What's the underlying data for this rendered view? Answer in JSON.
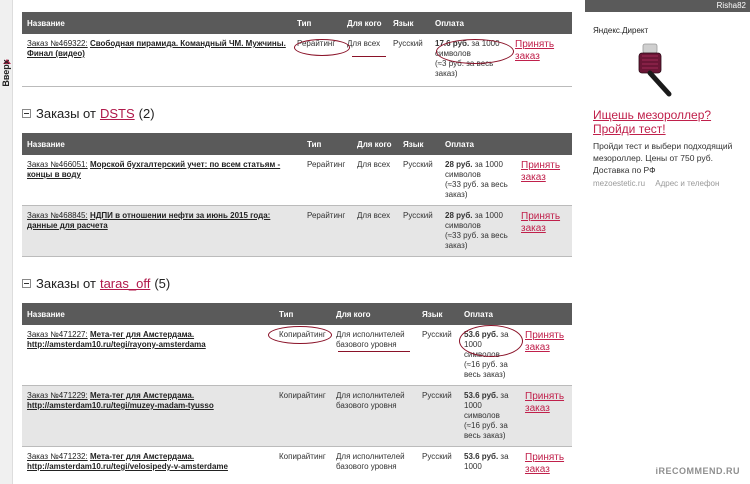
{
  "scroll_top": {
    "label": "Вверх"
  },
  "columns": {
    "name": "Название",
    "type": "Тип",
    "for_whom": "Для кого",
    "language": "Язык",
    "payment": "Оплата"
  },
  "groups": [
    {
      "title_prefix": "",
      "author": "",
      "count": "",
      "orders": [
        {
          "number": "Заказ №469322:",
          "title": "Свободная пирамида. Командный ЧМ. Мужчины. Финал (видео)",
          "url": "",
          "type": "Рерайтинг",
          "for_whom": "Для всех",
          "language": "Русский",
          "price": "17.6 руб.",
          "price_unit": "за 1000 символов",
          "total": "(≈3 руб. за весь заказ)",
          "accept": "Принять заказ"
        }
      ]
    },
    {
      "title_prefix": "Заказы от",
      "author": "DSTS",
      "count": "(2)",
      "orders": [
        {
          "number": "Заказ №466051:",
          "title": "Морской бухгалтерский учет: по всем статьям - концы в воду",
          "url": "",
          "type": "Рерайтинг",
          "for_whom": "Для всех",
          "language": "Русский",
          "price": "28 руб.",
          "price_unit": "за 1000 символов",
          "total": "(≈33 руб. за весь заказ)",
          "accept": "Принять заказ"
        },
        {
          "number": "Заказ №468845:",
          "title": "НДПИ в отношении нефти за июнь 2015 года: данные для расчета",
          "url": "",
          "type": "Рерайтинг",
          "for_whom": "Для всех",
          "language": "Русский",
          "price": "28 руб.",
          "price_unit": "за 1000 символов",
          "total": "(≈33 руб. за весь заказ)",
          "accept": "Принять заказ"
        }
      ]
    },
    {
      "title_prefix": "Заказы от",
      "author": "taras_off",
      "count": "(5)",
      "orders": [
        {
          "number": "Заказ №471227:",
          "title": "Мета-тег для Амстердама.",
          "url": "http://amsterdam10.ru/tegi/rayony-amsterdama",
          "type": "Копирайтинг",
          "for_whom": "Для исполнителей базового уровня",
          "language": "Русский",
          "price": "53.6 руб.",
          "price_unit": "за 1000 символов",
          "total": "(≈16 руб. за весь заказ)",
          "accept": "Принять заказ"
        },
        {
          "number": "Заказ №471229:",
          "title": "Мета-тег для Амстердама.",
          "url": "http://amsterdam10.ru/tegi/muzey-madam-tyusso",
          "type": "Копирайтинг",
          "for_whom": "Для исполнителей базового уровня",
          "language": "Русский",
          "price": "53.6 руб.",
          "price_unit": "за 1000 символов",
          "total": "(≈16 руб. за весь заказ)",
          "accept": "Принять заказ"
        },
        {
          "number": "Заказ №471232:",
          "title": "Мета-тег для Амстердама.",
          "url": "http://amsterdam10.ru/tegi/velosipedy-v-amsterdame",
          "type": "Копирайтинг",
          "for_whom": "Для исполнителей базового уровня",
          "language": "Русский",
          "price": "53.6 руб.",
          "price_unit": "за 1000",
          "total": "",
          "accept": "Принять заказ"
        }
      ]
    }
  ],
  "ad": {
    "user": "Risha82",
    "header": "Яндекс.Директ",
    "image_icon": "mesoroller-image",
    "title": "Ищешь мезороллер? Пройди тест!",
    "text": "Пройди тест и выбери подходящий мезороллер. Цены от 750 руб. Доставка по РФ",
    "domain": "mezoestetic.ru",
    "contact": "Адрес и телефон"
  },
  "watermark": "iRECOMMEND.RU",
  "colors": {
    "accent": "#c0204b",
    "header": "#5a5a5a",
    "row_alt": "#e6e6e6"
  }
}
